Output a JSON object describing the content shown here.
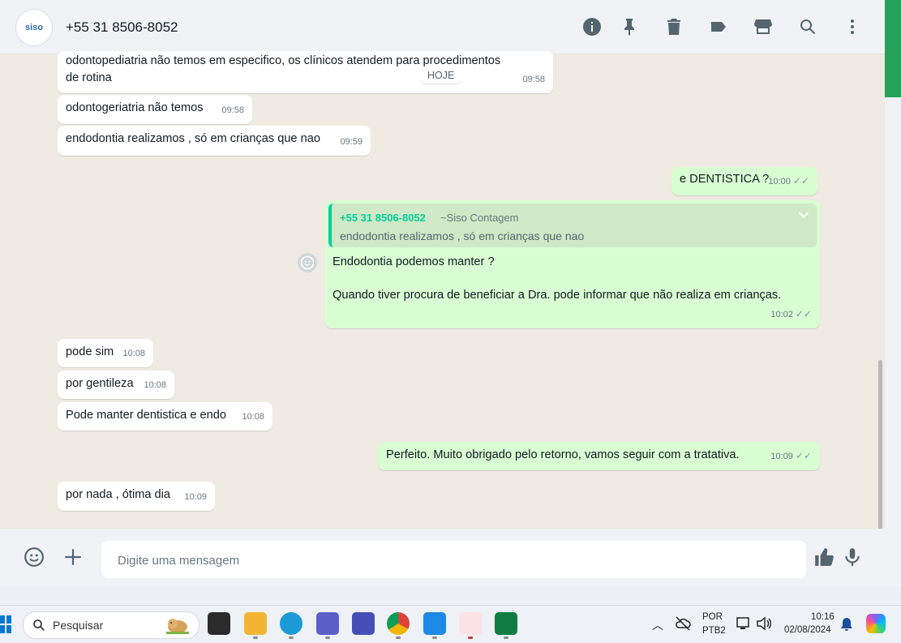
{
  "header": {
    "avatar_text": "siso",
    "title": "+55 31 8506-8052",
    "icons": [
      "info-icon",
      "pin-icon",
      "delete-icon",
      "label-icon",
      "store-icon",
      "search-icon",
      "menu-icon"
    ]
  },
  "date_chip": "HOJE",
  "messages": [
    {
      "dir": "in",
      "text_line1": "odontopediatria não temos em especifico, os clínicos atendem para procedimentos",
      "text_line2": "de rotina",
      "time": "09:58"
    },
    {
      "dir": "in",
      "text": "odontogeriatria não temos",
      "time": "09:58"
    },
    {
      "dir": "in",
      "text": "endodontia realizamos , só em crianças que nao",
      "time": "09:59"
    },
    {
      "dir": "out",
      "text": "e DENTISTICA ?",
      "time": "10:00"
    },
    {
      "dir": "out",
      "quote_name": "+55 31 8506-8052",
      "quote_sub": "~Siso Contagem",
      "quote_text": "endodontia realizamos , só em crianças que nao",
      "text_line1": "Endodontia podemos manter ?",
      "text_line2": "Quando tiver procura de beneficiar a Dra. pode informar que não realiza em crianças.",
      "time": "10:02"
    },
    {
      "dir": "in",
      "text": "pode sim",
      "time": "10:08"
    },
    {
      "dir": "in",
      "text": "por gentileza",
      "time": "10:08"
    },
    {
      "dir": "in",
      "text": "Pode manter dentistica e endo",
      "time": "10:08"
    },
    {
      "dir": "out",
      "text": "Perfeito. Muito obrigado pelo retorno, vamos seguir com a tratativa.",
      "time": "10:09"
    },
    {
      "dir": "in",
      "text": "por nada , ótima dia",
      "time": "10:09"
    }
  ],
  "composer": {
    "placeholder": "Digite uma mensagem"
  },
  "taskbar": {
    "search_label": "Pesquisar",
    "lang_top": "POR",
    "lang_bottom": "PTB2",
    "time": "10:16",
    "date": "02/08/2024"
  },
  "colors": {
    "accent": "#06cf9c",
    "outgoing": "#d9fdd3",
    "incoming": "#ffffff",
    "wallpaper": "#efeae2"
  }
}
